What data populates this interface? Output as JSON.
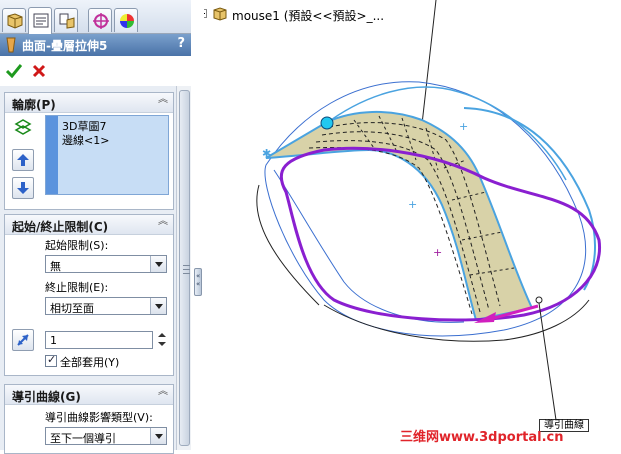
{
  "panel": {
    "tabs": [
      "feature-manager-icon",
      "property-manager-icon",
      "configuration-manager-icon",
      "dimxpert-icon",
      "display-manager-icon"
    ],
    "title": "曲面-疊層拉伸5",
    "help": "?",
    "ok_icon": "check-icon",
    "cancel_icon": "x-icon"
  },
  "profile": {
    "header": "輪廓(P)",
    "items": [
      "3D草圖7",
      "邊線<1>"
    ]
  },
  "start_end": {
    "header": "起始/終止限制(C)",
    "start_label": "起始限制(S):",
    "start_value": "無",
    "end_label": "終止限制(E):",
    "end_value": "相切至面",
    "length_value": "1",
    "apply_all_label": "全部套用(Y)"
  },
  "guide": {
    "header": "導引曲線(G)",
    "influence_label": "導引曲線影響類型(V):",
    "influence_value": "至下一個導引"
  },
  "viewport": {
    "tree_label": "mouse1  (預設<<預設>_...",
    "guide_callout": "導引曲線",
    "watermark": "三维网www.3dportal.cn"
  },
  "colors": {
    "title_bar": "#4a73a8",
    "selection": "#c7ddf5",
    "profile_curve": "#8a1fd0",
    "edge_blue": "#4aa3e0",
    "surface": "#d8d2a8",
    "guide_arrow": "#d11fbf"
  }
}
